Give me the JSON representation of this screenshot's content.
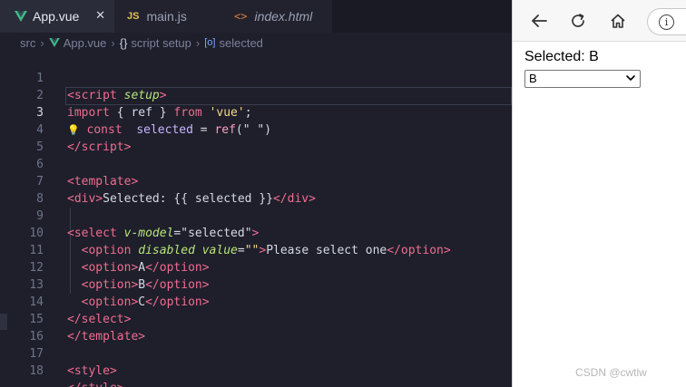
{
  "tabs": [
    {
      "label": "App.vue",
      "icon": "vue-icon",
      "active": true
    },
    {
      "label": "main.js",
      "icon": "js-icon",
      "badge": "JS",
      "active": false
    },
    {
      "label": "index.html",
      "icon": "html-icon",
      "badge": "<>",
      "active": false
    }
  ],
  "close_glyph": "✕",
  "breadcrumb": {
    "folder": "src",
    "file": "App.vue",
    "section_icon": "{}",
    "section": "script setup",
    "symbol_icon": "[o]",
    "symbol": "selected"
  },
  "line_numbers": [
    "1",
    "2",
    "3",
    "4",
    "5",
    "6",
    "7",
    "8",
    "9",
    "10",
    "11",
    "12",
    "13",
    "14",
    "15",
    "16",
    "17",
    "18"
  ],
  "code": {
    "l1": {
      "open": "<",
      "tag": "script",
      "attr": "setup",
      "close": ">"
    },
    "l2": {
      "import": "import",
      "brace_open": "{ ",
      "name": "ref",
      "brace_close": " }",
      "from": "from",
      "module": "'vue'",
      "semi": ";"
    },
    "l3": {
      "bulb": "💡",
      "const": "const",
      "var": "selected",
      "eq": " = ",
      "fn": "ref",
      "arg": "(\" \")"
    },
    "l4": {
      "open": "</",
      "tag": "script",
      "close": ">"
    },
    "l6": {
      "open": "<",
      "tag": "template",
      "close": ">"
    },
    "l7": {
      "open1": "<",
      "tag1": "div",
      "close1": ">",
      "text": "Selected: {{ selected }}",
      "open2": "</",
      "tag2": "div",
      "close2": ">"
    },
    "l9": {
      "open": "<",
      "tag": "select",
      "attr": "v-model",
      "eq": "=",
      "val": "\"selected\"",
      "close": ">"
    },
    "l10": {
      "open1": "<",
      "tag1": "option",
      "attr1": "disabled",
      "attr2": "value",
      "eq": "=",
      "val": "\"\"",
      "close1": ">",
      "text": "Please select one",
      "open2": "</",
      "tag2": "option",
      "close2": ">"
    },
    "l11": {
      "open1": "<",
      "tag1": "option",
      "close1": ">",
      "text": "A",
      "open2": "</",
      "tag2": "option",
      "close2": ">"
    },
    "l12": {
      "open1": "<",
      "tag1": "option",
      "close1": ">",
      "text": "B",
      "open2": "</",
      "tag2": "option",
      "close2": ">"
    },
    "l13": {
      "open1": "<",
      "tag1": "option",
      "close1": ">",
      "text": "C",
      "open2": "</",
      "tag2": "option",
      "close2": ">"
    },
    "l14": {
      "open": "</",
      "tag": "select",
      "close": ">"
    },
    "l15": {
      "open": "</",
      "tag": "template",
      "close": ">"
    },
    "l17": {
      "open": "<",
      "tag": "style",
      "close": ">"
    },
    "l18": {
      "open": "</",
      "tag": "style",
      "close": ">"
    }
  },
  "browser": {
    "back_icon": "back-arrow-icon",
    "reload_icon": "reload-icon",
    "home_icon": "home-icon",
    "info_glyph": "i",
    "selected_text": "Selected: B",
    "select_value": "B",
    "select_options": [
      "Please select one",
      "A",
      "B",
      "C"
    ]
  },
  "watermark": "CSDN @cwtlw"
}
